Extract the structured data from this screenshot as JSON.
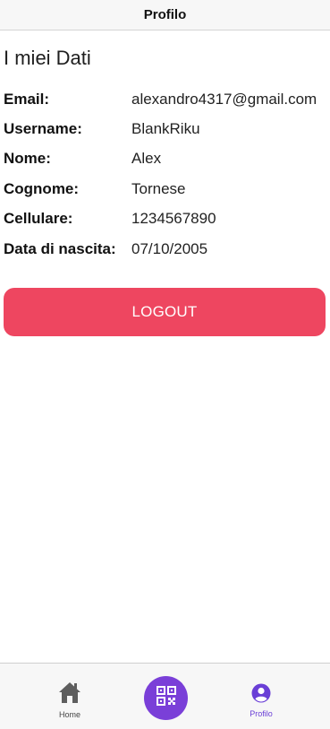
{
  "header": {
    "title": "Profilo"
  },
  "section": {
    "title": "I miei Dati"
  },
  "profile": [
    {
      "label": "Email:",
      "value": "alexandro4317@gmail.com"
    },
    {
      "label": "Username:",
      "value": "BlankRiku"
    },
    {
      "label": "Nome:",
      "value": "Alex"
    },
    {
      "label": "Cognome:",
      "value": "Tornese"
    },
    {
      "label": "Cellulare:",
      "value": "1234567890"
    },
    {
      "label": "Data di nascita:",
      "value": "07/10/2005"
    }
  ],
  "actions": {
    "logout_label": "LOGOUT"
  },
  "tabbar": {
    "home_label": "Home",
    "home_icon": "home-icon",
    "scan_icon": "qr-code-icon",
    "profile_label": "Profilo",
    "profile_icon": "user-circle-icon"
  },
  "colors": {
    "logout": "#ee4660",
    "accent": "#7a3fd8"
  }
}
